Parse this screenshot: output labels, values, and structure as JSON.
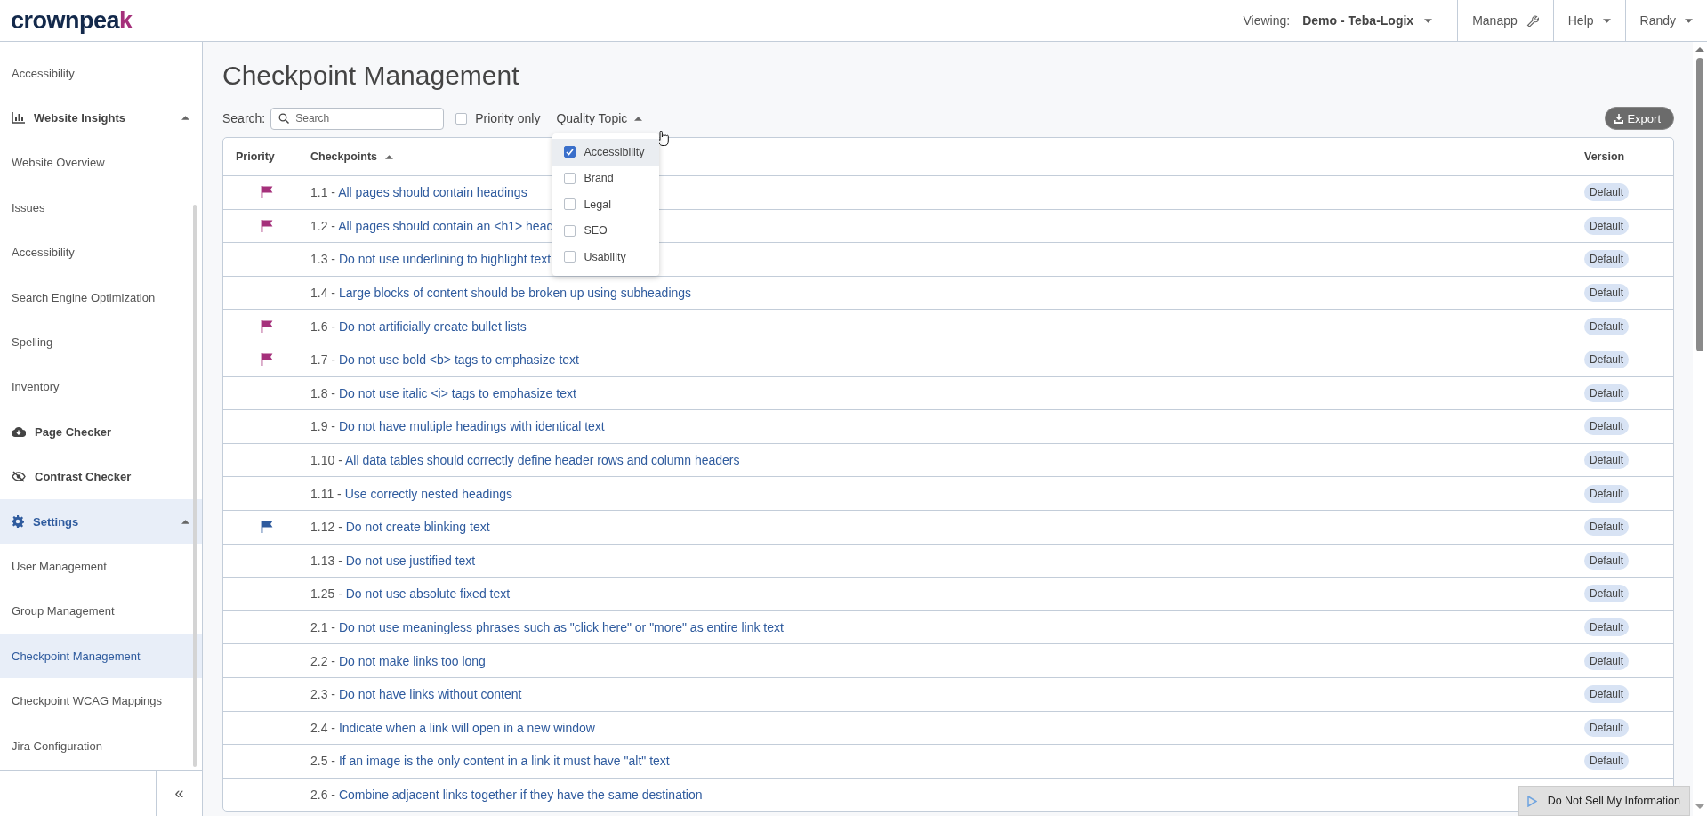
{
  "header": {
    "logo": {
      "text": "crownpea",
      "accent": "k"
    },
    "viewing_label": "Viewing:",
    "site": "Demo - Teba-Logix",
    "menus": [
      {
        "label": "Manapp",
        "kind": "tool"
      },
      {
        "label": "Help",
        "kind": "dropdown"
      },
      {
        "label": "Randy",
        "kind": "dropdown"
      }
    ]
  },
  "sidebar": {
    "items": [
      {
        "label": "Accessibility",
        "kind": "link",
        "selected": false
      },
      {
        "label": "Website Insights",
        "kind": "section",
        "expanded": true,
        "selected": false
      },
      {
        "label": "Website Overview",
        "kind": "link",
        "selected": false
      },
      {
        "label": "Issues",
        "kind": "link",
        "selected": false
      },
      {
        "label": "Accessibility",
        "kind": "link",
        "selected": false
      },
      {
        "label": "Search Engine Optimization",
        "kind": "link",
        "selected": false
      },
      {
        "label": "Spelling",
        "kind": "link",
        "selected": false
      },
      {
        "label": "Inventory",
        "kind": "link",
        "selected": false
      },
      {
        "label": "Page Checker",
        "kind": "section",
        "selected": false
      },
      {
        "label": "Contrast Checker",
        "kind": "section",
        "selected": false
      },
      {
        "label": "Settings",
        "kind": "section",
        "expanded": true,
        "selected": true
      },
      {
        "label": "User Management",
        "kind": "link",
        "selected": false
      },
      {
        "label": "Group Management",
        "kind": "link",
        "selected": false
      },
      {
        "label": "Checkpoint Management",
        "kind": "link",
        "selected": true
      },
      {
        "label": "Checkpoint WCAG Mappings",
        "kind": "link",
        "selected": false
      },
      {
        "label": "Jira Configuration",
        "kind": "link",
        "selected": false
      }
    ],
    "collapse": "«"
  },
  "page": {
    "title": "Checkpoint Management",
    "search_label": "Search:",
    "search": {
      "placeholder": "Search"
    },
    "priority_only": {
      "label": "Priority only",
      "checked": false
    },
    "quality_topic": {
      "label": "Quality Topic",
      "expanded": true,
      "options": [
        {
          "label": "Accessibility",
          "checked": true,
          "hovered": true
        },
        {
          "label": "Brand",
          "checked": false,
          "hovered": false
        },
        {
          "label": "Legal",
          "checked": false,
          "hovered": false
        },
        {
          "label": "SEO",
          "checked": false,
          "hovered": false
        },
        {
          "label": "Usability",
          "checked": false,
          "hovered": false
        }
      ]
    },
    "export": "Export"
  },
  "table": {
    "columns": [
      {
        "label": "Priority",
        "sorted": false
      },
      {
        "label": "Checkpoints",
        "sorted": true
      },
      {
        "label": "Version",
        "sorted": false
      }
    ],
    "rows": [
      {
        "num": "1.1 -",
        "title": "All pages should contain headings",
        "flagged": true,
        "color": "#a5307b",
        "version": "Default"
      },
      {
        "num": "1.2 -",
        "title": "All pages should contain an <h1> head",
        "flagged": true,
        "color": "#a5307b",
        "version": "Default"
      },
      {
        "num": "1.3 -",
        "title": "Do not use underlining to highlight text",
        "flagged": false,
        "version": "Default"
      },
      {
        "num": "1.4 -",
        "title": "Large blocks of content should be broken up using subheadings",
        "flagged": false,
        "version": "Default"
      },
      {
        "num": "1.6 -",
        "title": "Do not artificially create bullet lists",
        "flagged": true,
        "color": "#a5307b",
        "version": "Default"
      },
      {
        "num": "1.7 -",
        "title": "Do not use bold <b> tags to emphasize text",
        "flagged": true,
        "color": "#a5307b",
        "version": "Default"
      },
      {
        "num": "1.8 -",
        "title": "Do not use italic <i> tags to emphasize text",
        "flagged": false,
        "version": "Default"
      },
      {
        "num": "1.9 -",
        "title": "Do not have multiple headings with identical text",
        "flagged": false,
        "version": "Default"
      },
      {
        "num": "1.10 -",
        "title": "All data tables should correctly define header rows and column headers",
        "flagged": false,
        "version": "Default"
      },
      {
        "num": "1.11 -",
        "title": "Use correctly nested headings",
        "flagged": false,
        "version": "Default"
      },
      {
        "num": "1.12 -",
        "title": "Do not create blinking text",
        "flagged": true,
        "color": "#2f5b9e",
        "version": "Default"
      },
      {
        "num": "1.13 -",
        "title": "Do not use justified text",
        "flagged": false,
        "version": "Default"
      },
      {
        "num": "1.25 -",
        "title": "Do not use absolute fixed text",
        "flagged": false,
        "version": "Default"
      },
      {
        "num": "2.1 -",
        "title": "Do not use meaningless phrases such as \"click here\" or \"more\" as entire link text",
        "flagged": false,
        "version": "Default"
      },
      {
        "num": "2.2 -",
        "title": "Do not make links too long",
        "flagged": false,
        "version": "Default"
      },
      {
        "num": "2.3 -",
        "title": "Do not have links without content",
        "flagged": false,
        "version": "Default"
      },
      {
        "num": "2.4 -",
        "title": "Indicate when a link will open in a new window",
        "flagged": false,
        "version": "Default"
      },
      {
        "num": "2.5 -",
        "title": "If an image is the only content in a link it must have \"alt\" text",
        "flagged": false,
        "version": "Default"
      },
      {
        "num": "2.6 -",
        "title": "Combine adjacent links together if they have the same destination",
        "flagged": false
      }
    ]
  },
  "do_not_sell": "Do Not Sell My Information"
}
